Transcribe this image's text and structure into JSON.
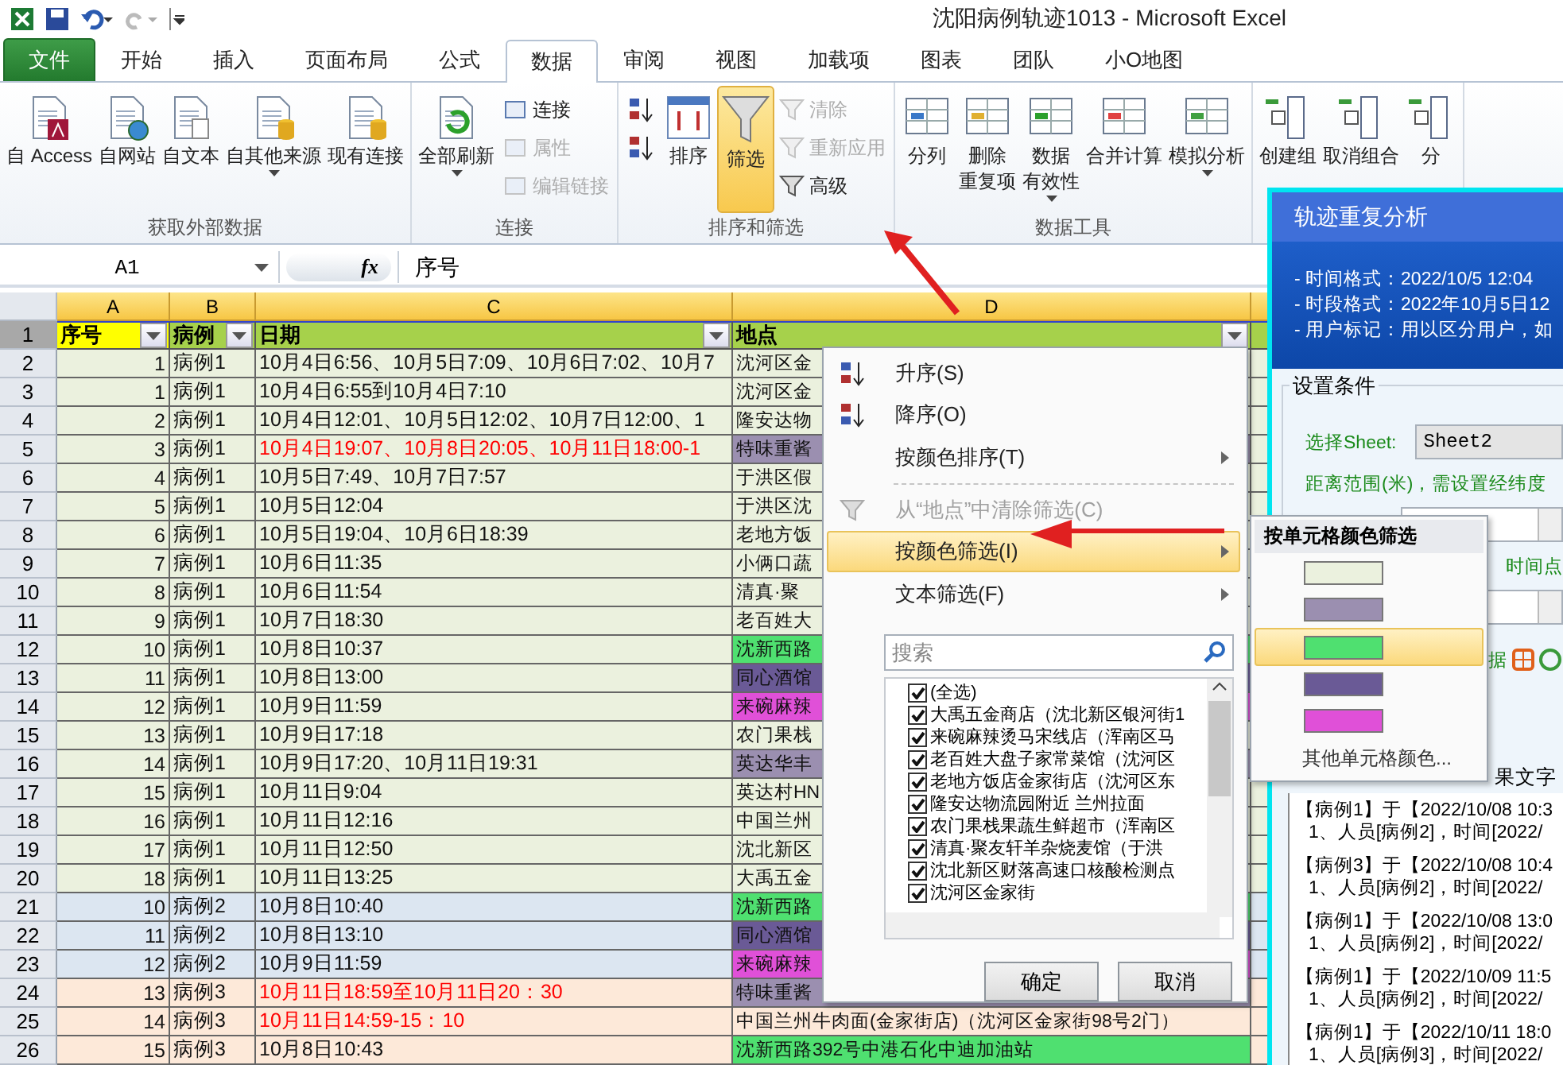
{
  "window": {
    "title": "沈阳病例轨迹1013  -  Microsoft Excel"
  },
  "ribbon_tabs": [
    {
      "label": "文件",
      "kind": "file",
      "selected": false
    },
    {
      "label": "开始",
      "kind": "tab",
      "selected": false
    },
    {
      "label": "插入",
      "kind": "tab",
      "selected": false
    },
    {
      "label": "页面布局",
      "kind": "tab",
      "selected": false
    },
    {
      "label": "公式",
      "kind": "tab",
      "selected": false
    },
    {
      "label": "数据",
      "kind": "tab",
      "selected": true
    },
    {
      "label": "审阅",
      "kind": "tab",
      "selected": false
    },
    {
      "label": "视图",
      "kind": "tab",
      "selected": false
    },
    {
      "label": "加载项",
      "kind": "tab",
      "selected": false
    },
    {
      "label": "图表",
      "kind": "tab",
      "selected": false
    },
    {
      "label": "团队",
      "kind": "tab",
      "selected": false
    },
    {
      "label": "小O地图",
      "kind": "tab",
      "selected": false
    }
  ],
  "ribbon_groups": [
    {
      "label": "获取外部数据",
      "items": [
        {
          "kind": "large",
          "lines": [
            "自 Access"
          ],
          "dropdown": false,
          "selected": false
        },
        {
          "kind": "large",
          "lines": [
            "自网站"
          ],
          "dropdown": false,
          "selected": false
        },
        {
          "kind": "large",
          "lines": [
            "自文本"
          ],
          "dropdown": false,
          "selected": false
        },
        {
          "kind": "large",
          "lines": [
            "自其他来源"
          ],
          "dropdown": true,
          "selected": false
        },
        {
          "kind": "large",
          "lines": [
            "现有连接"
          ],
          "dropdown": false,
          "selected": false
        }
      ]
    },
    {
      "label": "连接",
      "items": [
        {
          "kind": "large",
          "lines": [
            "全部刷新"
          ],
          "dropdown": true,
          "selected": false
        },
        {
          "kind": "stack",
          "buttons": [
            {
              "label": "连接",
              "disabled": false
            },
            {
              "label": "属性",
              "disabled": true
            },
            {
              "label": "编辑链接",
              "disabled": true
            }
          ]
        }
      ]
    },
    {
      "label": "排序和筛选",
      "items": [
        {
          "kind": "stack",
          "buttons": [
            {
              "disabled": false
            },
            {
              "disabled": false
            }
          ]
        },
        {
          "kind": "large",
          "lines": [
            "排序"
          ],
          "dropdown": false,
          "selected": false
        },
        {
          "kind": "large",
          "lines": [
            "筛选"
          ],
          "dropdown": false,
          "selected": true
        },
        {
          "kind": "stack",
          "buttons": [
            {
              "label": "清除",
              "disabled": true
            },
            {
              "label": "重新应用",
              "disabled": true
            },
            {
              "label": "高级",
              "disabled": false
            }
          ]
        }
      ]
    },
    {
      "label": "数据工具",
      "items": [
        {
          "kind": "large",
          "lines": [
            "分列"
          ],
          "dropdown": false,
          "selected": false
        },
        {
          "kind": "large",
          "lines": [
            "删除",
            "重复项"
          ],
          "dropdown": false,
          "selected": false
        },
        {
          "kind": "large",
          "lines": [
            "数据",
            "有效性"
          ],
          "dropdown": true,
          "selected": false
        },
        {
          "kind": "large",
          "lines": [
            "合并计算"
          ],
          "dropdown": false,
          "selected": false
        },
        {
          "kind": "large",
          "lines": [
            "模拟分析"
          ],
          "dropdown": true,
          "selected": false
        }
      ]
    },
    {
      "items": [
        {
          "kind": "large",
          "lines": [
            "创建组"
          ],
          "dropdown": false,
          "selected": false
        },
        {
          "kind": "large",
          "lines": [
            "取消组合"
          ],
          "dropdown": false,
          "selected": false
        },
        {
          "kind": "large",
          "lines": [
            "分"
          ],
          "dropdown": false,
          "selected": false
        }
      ]
    }
  ],
  "formula_bar": {
    "cell": "A1",
    "function_label": "fx",
    "value": "序号"
  },
  "sheet": {
    "columns": [
      "A",
      "B",
      "C",
      "D"
    ],
    "header_row": {
      "row": "1",
      "cells": [
        {
          "text": "序号",
          "color": "#ffff00",
          "filter": true
        },
        {
          "text": "病例",
          "color": "#a6d14b",
          "filter": true
        },
        {
          "text": "日期",
          "color": "#a6d14b",
          "filter": true
        },
        {
          "text": "地点",
          "color": "#a6d14b",
          "filter": true
        }
      ]
    },
    "rows": [
      {
        "row": "2",
        "number": "1",
        "case": "病例1",
        "color": "#ebf1de",
        "date": "10月4日6:56、10月5日7:09、10月6日7:02、10月7",
        "date_red": false,
        "location": {
          "text": "沈河区金"
        }
      },
      {
        "row": "3",
        "number": "1",
        "case": "病例1",
        "color": "#ebf1de",
        "date": "10月4日6:55到10月4日7:10",
        "date_red": false,
        "location": {
          "text": "沈河区金"
        }
      },
      {
        "row": "4",
        "number": "2",
        "case": "病例1",
        "color": "#ebf1de",
        "date": "10月4日12:01、10月5日12:02、10月7日12:00、1",
        "date_red": false,
        "location": {
          "text": "隆安达物"
        }
      },
      {
        "row": "5",
        "number": "3",
        "case": "病例1",
        "color": "#ebf1de",
        "date": "10月4日19:07、10月8日20:05、10月11日18:00-1",
        "date_red": true,
        "location": {
          "text": "特味重酱",
          "color": "#9b8fb0"
        }
      },
      {
        "row": "6",
        "number": "4",
        "case": "病例1",
        "color": "#ebf1de",
        "date": "10月5日7:49、10月7日7:57",
        "date_red": false,
        "location": {
          "text": "于洪区假"
        }
      },
      {
        "row": "7",
        "number": "5",
        "case": "病例1",
        "color": "#ebf1de",
        "date": "10月5日12:04",
        "date_red": false,
        "location": {
          "text": "于洪区沈"
        }
      },
      {
        "row": "8",
        "number": "6",
        "case": "病例1",
        "color": "#ebf1de",
        "date": "10月5日19:04、10月6日18:39",
        "date_red": false,
        "location": {
          "text": "老地方饭"
        }
      },
      {
        "row": "9",
        "number": "7",
        "case": "病例1",
        "color": "#ebf1de",
        "date": "10月6日11:35",
        "date_red": false,
        "location": {
          "text": "小俩口蔬"
        }
      },
      {
        "row": "10",
        "number": "8",
        "case": "病例1",
        "color": "#ebf1de",
        "date": "10月6日11:54",
        "date_red": false,
        "location": {
          "text": "清真·聚"
        }
      },
      {
        "row": "11",
        "number": "9",
        "case": "病例1",
        "color": "#ebf1de",
        "date": "10月7日18:30",
        "date_red": false,
        "location": {
          "text": "老百姓大"
        }
      },
      {
        "row": "12",
        "number": "10",
        "case": "病例1",
        "color": "#ebf1de",
        "date": "10月8日10:37",
        "date_red": false,
        "location": {
          "text": "沈新西路",
          "color": "#4fe070"
        }
      },
      {
        "row": "13",
        "number": "11",
        "case": "病例1",
        "color": "#ebf1de",
        "date": "10月8日13:00",
        "date_red": false,
        "location": {
          "text": "同心酒馆",
          "color": "#6a5a96"
        }
      },
      {
        "row": "14",
        "number": "12",
        "case": "病例1",
        "color": "#ebf1de",
        "date": "10月9日11:59",
        "date_red": false,
        "location": {
          "text": "来碗麻辣",
          "color": "#e050d8"
        }
      },
      {
        "row": "15",
        "number": "13",
        "case": "病例1",
        "color": "#ebf1de",
        "date": "10月9日17:18",
        "date_red": false,
        "location": {
          "text": "农门果栈"
        }
      },
      {
        "row": "16",
        "number": "14",
        "case": "病例1",
        "color": "#ebf1de",
        "date": "10月9日17:20、10月11日19:31",
        "date_red": false,
        "location": {
          "text": "英达华丰",
          "color": "#9b8fb0"
        }
      },
      {
        "row": "17",
        "number": "15",
        "case": "病例1",
        "color": "#ebf1de",
        "date": "10月11日9:04",
        "date_red": false,
        "location": {
          "text": "英达村HN"
        }
      },
      {
        "row": "18",
        "number": "16",
        "case": "病例1",
        "color": "#ebf1de",
        "date": "10月11日12:16",
        "date_red": false,
        "location": {
          "text": "中国兰州"
        }
      },
      {
        "row": "19",
        "number": "17",
        "case": "病例1",
        "color": "#ebf1de",
        "date": "10月11日12:50",
        "date_red": false,
        "location": {
          "text": "沈北新区"
        }
      },
      {
        "row": "20",
        "number": "18",
        "case": "病例1",
        "color": "#ebf1de",
        "date": "10月11日13:25",
        "date_red": false,
        "location": {
          "text": "大禹五金"
        }
      },
      {
        "row": "21",
        "number": "10",
        "case": "病例2",
        "color": "#dce6f1",
        "date": "10月8日10:40",
        "date_red": false,
        "location": {
          "text": "沈新西路",
          "color": "#4fe070"
        }
      },
      {
        "row": "22",
        "number": "11",
        "case": "病例2",
        "color": "#dce6f1",
        "date": "10月8日13:10",
        "date_red": false,
        "location": {
          "text": "同心酒馆",
          "color": "#6a5a96"
        }
      },
      {
        "row": "23",
        "number": "12",
        "case": "病例2",
        "color": "#dce6f1",
        "date": "10月9日11:59",
        "date_red": false,
        "location": {
          "text": "来碗麻辣",
          "color": "#e050d8"
        }
      },
      {
        "row": "24",
        "number": "13",
        "case": "病例3",
        "color": "#fde9d9",
        "date": "10月11日18:59至10月11日20：30",
        "date_red": true,
        "location": {
          "text": "特味重酱",
          "color": "#9b8fb0"
        }
      },
      {
        "row": "25",
        "number": "14",
        "case": "病例3",
        "color": "#fde9d9",
        "date": "10月11日14:59-15：10",
        "date_red": true,
        "location": {
          "text": "中国兰州牛肉面(金家街店)（沈河区金家街98号2门）"
        }
      },
      {
        "row": "26",
        "number": "15",
        "case": "病例3",
        "color": "#fde9d9",
        "date": "10月8日10:43",
        "date_red": false,
        "location": {
          "text": "沈新西路392号中港石化中迪加油站",
          "color": "#4fe070"
        }
      }
    ]
  },
  "filter_menu": {
    "items": [
      {
        "label": "升序(S)",
        "kind": "sort_asc",
        "disabled": false,
        "highlighted": false,
        "submenu": false
      },
      {
        "label": "降序(O)",
        "kind": "sort_desc",
        "disabled": false,
        "highlighted": false,
        "submenu": false
      },
      {
        "label": "按颜色排序(T)",
        "kind": "plain",
        "disabled": false,
        "highlighted": false,
        "submenu": true
      },
      {
        "label": "从“地点”中清除筛选(C)",
        "kind": "clear",
        "disabled": true,
        "highlighted": false,
        "submenu": false
      },
      {
        "label": "按颜色筛选(I)",
        "kind": "plain",
        "disabled": false,
        "highlighted": true,
        "submenu": true
      },
      {
        "label": "文本筛选(F)",
        "kind": "plain",
        "disabled": false,
        "highlighted": false,
        "submenu": true
      }
    ],
    "search": {
      "placeholder": "搜索"
    },
    "values": [
      {
        "label": "(全选)",
        "checked": true
      },
      {
        "label": "大禹五金商店（沈北新区银河街1",
        "checked": true
      },
      {
        "label": "来碗麻辣烫马宋线店（浑南区马",
        "checked": true
      },
      {
        "label": "老百姓大盘子家常菜馆（沈河区",
        "checked": true
      },
      {
        "label": "老地方饭店金家街店（沈河区东",
        "checked": true
      },
      {
        "label": "隆安达物流园附近 兰州拉面",
        "checked": true
      },
      {
        "label": "农门果栈果蔬生鲜超市（浑南区",
        "checked": true
      },
      {
        "label": "清真·聚友轩羊杂烧麦馆（于洪",
        "checked": true
      },
      {
        "label": "沈北新区财落高速口核酸检测点",
        "checked": true
      },
      {
        "label": "沈河区金家街",
        "checked": true
      }
    ],
    "buttons": [
      "确定",
      "取消"
    ]
  },
  "color_submenu": {
    "title": "按单元格颜色筛选",
    "swatches": [
      {
        "color": "#ebf1de",
        "selected": false
      },
      {
        "color": "#9b8fb0",
        "selected": false
      },
      {
        "color": "#4fe070",
        "selected": true
      },
      {
        "color": "#6a5a96",
        "selected": false
      },
      {
        "color": "#e050d8",
        "selected": false
      }
    ],
    "more": "其他单元格颜色..."
  },
  "dialog": {
    "title": "轨迹重复分析",
    "notes": [
      "- 时间格式：2022/10/5 12:04",
      "- 时段格式：2022年10月5日12",
      "- 用户标记：用以区分用户，如"
    ],
    "section": "设置条件",
    "sheet_label": "选择Sheet:",
    "sheet_value": "Sheet2",
    "distance_label": "距离范围(米)，需设置经纬度",
    "time_label": "时间点",
    "toolbar_label": "据",
    "result_label": "果文字",
    "results": [
      {
        "head": "【病例1】于【2022/10/08 10:3",
        "detail": "1、人员[病例2]，时间[2022/"
      },
      {
        "head": "【病例3】于【2022/10/08 10:4",
        "detail": "1、人员[病例2]，时间[2022/"
      },
      {
        "head": "【病例1】于【2022/10/08 13:0",
        "detail": "1、人员[病例2]，时间[2022/"
      },
      {
        "head": "【病例1】于【2022/10/09 11:5",
        "detail": "1、人员[病例2]，时间[2022/"
      },
      {
        "head": "【病例1】于【2022/10/11 18:0",
        "detail": "1、人员[病例3]，时间[2022/"
      }
    ]
  }
}
